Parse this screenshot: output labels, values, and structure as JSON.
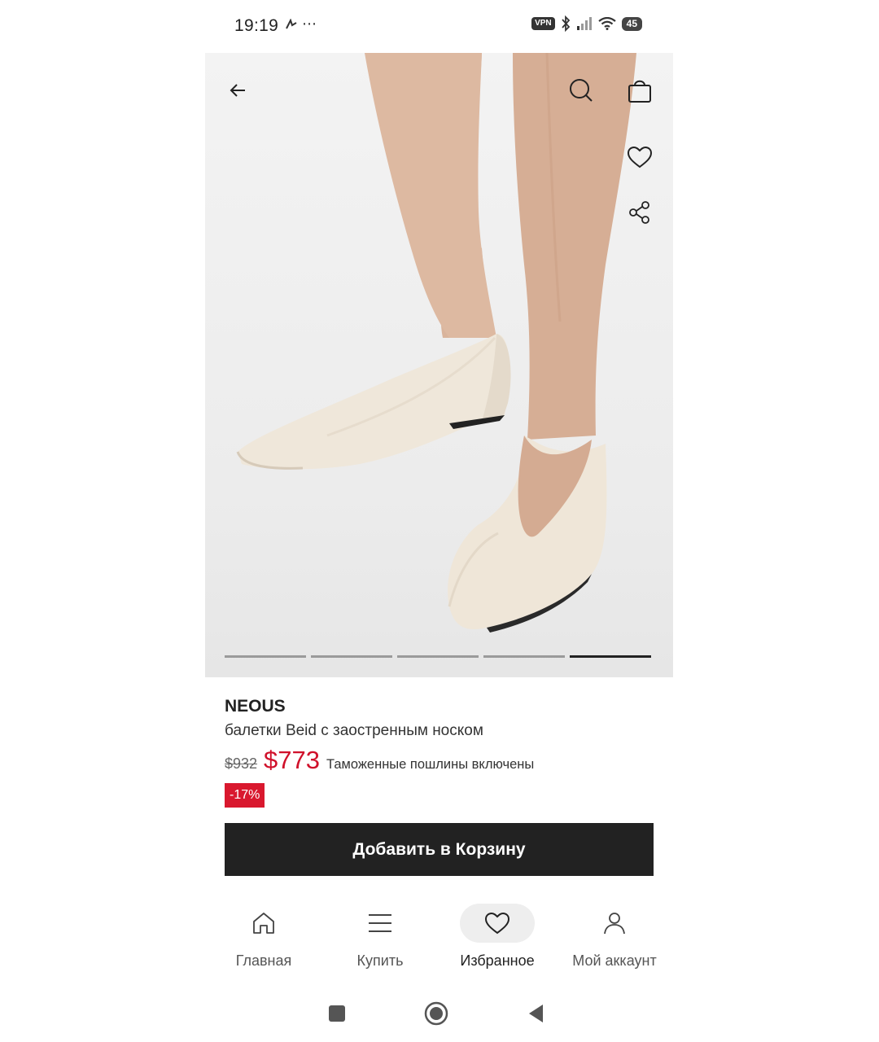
{
  "status_bar": {
    "time": "19:19",
    "extra": "⋯",
    "vpn": "VPN",
    "battery": "45"
  },
  "product": {
    "brand": "NEOUS",
    "name": "балетки Beid с заостренным носком",
    "old_price": "$932",
    "price": "$773",
    "duty_note": "Таможенные пошлины включены",
    "discount": "-17%",
    "add_to_cart": "Добавить в Корзину",
    "gallery": {
      "count": 5,
      "active_index": 5
    }
  },
  "bottom_nav": {
    "items": [
      {
        "label": "Главная",
        "icon": "home-icon"
      },
      {
        "label": "Купить",
        "icon": "menu-icon"
      },
      {
        "label": "Избранное",
        "icon": "heart-icon",
        "active": true
      },
      {
        "label": "Мой аккаунт",
        "icon": "user-icon"
      }
    ]
  },
  "colors": {
    "price": "#d0112b",
    "discount_badge": "#d9182e",
    "button_bg": "#222222"
  }
}
